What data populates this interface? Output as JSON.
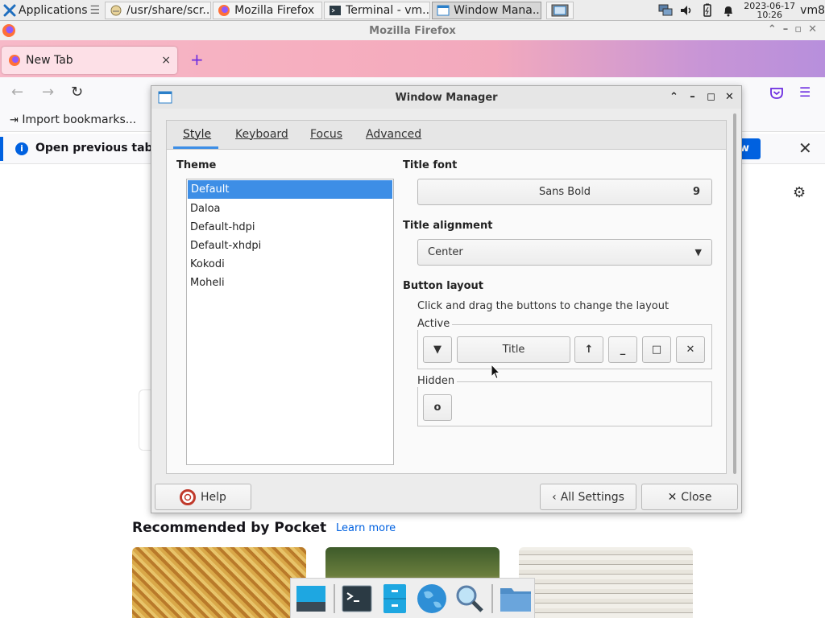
{
  "panel": {
    "apps_label": "Applications",
    "tasks": [
      {
        "label": "/usr/share/scr..."
      },
      {
        "label": "Mozilla Firefox"
      },
      {
        "label": "Terminal - vm..."
      },
      {
        "label": "Window Mana..."
      }
    ],
    "clock_date": "2023-06-17",
    "clock_time": "10:26",
    "user": "vm8"
  },
  "firefox": {
    "window_title": "Mozilla Firefox",
    "tab_label": "New Tab",
    "tab_close": "×",
    "new_tab": "+",
    "bookmark_import": "Import bookmarks...",
    "info_icon": "i",
    "info_text": "Open previous tabs",
    "info_button": "w",
    "info_close": "✕",
    "pocket_title": "Recommended by Pocket",
    "pocket_link": "Learn more",
    "accent_color": "#0061e0"
  },
  "wm": {
    "title": "Window Manager",
    "tabs": [
      {
        "label": "Style"
      },
      {
        "label": "Keyboard"
      },
      {
        "label": "Focus"
      },
      {
        "label": "Advanced"
      }
    ],
    "theme_label": "Theme",
    "themes": [
      {
        "label": "Default",
        "selected": true
      },
      {
        "label": "Daloa"
      },
      {
        "label": "Default-hdpi"
      },
      {
        "label": "Default-xhdpi"
      },
      {
        "label": "Kokodi"
      },
      {
        "label": "Moheli"
      }
    ],
    "title_font_label": "Title font",
    "title_font_name": "Sans Bold",
    "title_font_size": "9",
    "title_alignment_label": "Title alignment",
    "title_alignment_value": "Center",
    "button_layout_label": "Button layout",
    "button_layout_hint": "Click and drag the buttons to change the layout",
    "active_label": "Active",
    "active_buttons": {
      "menu": "▼",
      "title": "Title",
      "shade": "↑",
      "minimize": "_",
      "maximize": "□",
      "close": "✕"
    },
    "hidden_label": "Hidden",
    "hidden_buttons": {
      "stick": "o"
    },
    "help": "Help",
    "all_settings": "All Settings",
    "close": "Close",
    "selection_color": "#3d8ee6"
  }
}
